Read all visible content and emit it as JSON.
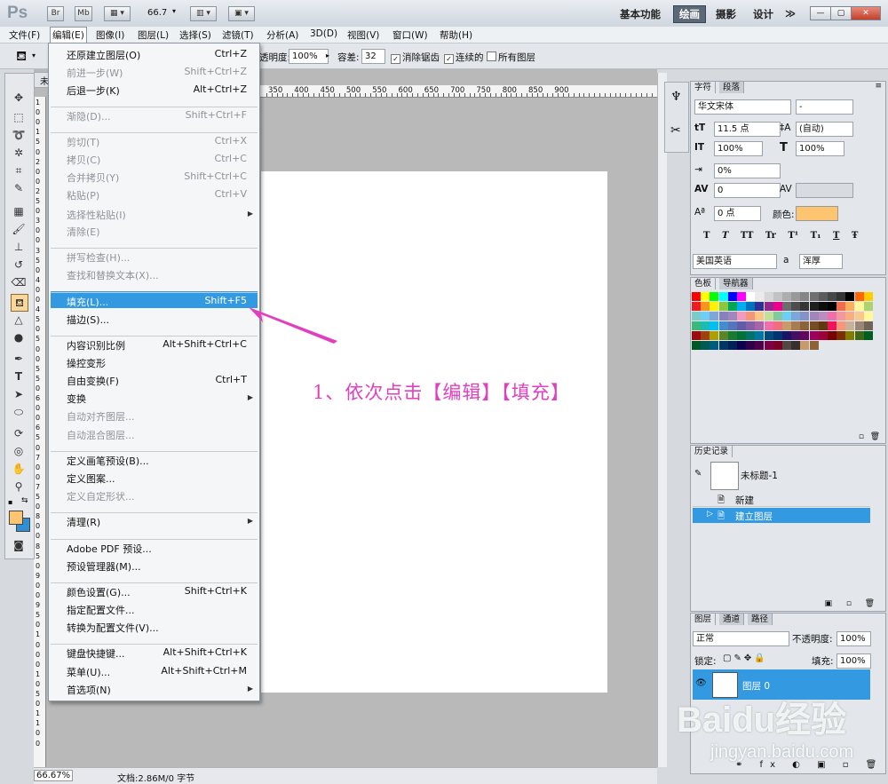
{
  "app": {
    "logo": "Ps",
    "zoom": "66.7",
    "bridge": "Br",
    "minibridge": "Mb"
  },
  "workspaces": [
    "基本功能",
    "绘画",
    "摄影",
    "设计",
    "≫"
  ],
  "menubar": [
    "文件(F)",
    "编辑(E)",
    "图像(I)",
    "图层(L)",
    "选择(S)",
    "滤镜(T)",
    "分析(A)",
    "3D(D)",
    "视图(V)",
    "窗口(W)",
    "帮助(H)"
  ],
  "options": {
    "opacity_label": "透明度:",
    "opacity": "100%",
    "tolerance_label": "容差:",
    "tolerance": "32",
    "antialias": "消除锯齿",
    "contiguous": "连续的",
    "all_layers": "所有图层"
  },
  "doc_tab": "未",
  "ruler_top": [
    "350",
    "400",
    "450",
    "500",
    "550",
    "600",
    "650",
    "700",
    "750",
    "800",
    "850",
    "900"
  ],
  "ruler_left": [
    "1",
    "0",
    "0",
    "1",
    "5",
    "0",
    "2",
    "0",
    "0",
    "2",
    "5",
    "0",
    "3",
    "0",
    "0",
    "3",
    "5",
    "0",
    "4",
    "0",
    "0",
    "4",
    "5",
    "0",
    "5",
    "0",
    "0",
    "5",
    "5",
    "0",
    "6",
    "0",
    "0",
    "6",
    "5",
    "0",
    "7",
    "0",
    "0",
    "7",
    "5",
    "0",
    "8",
    "0",
    "0",
    "8",
    "5",
    "0",
    "9",
    "0",
    "0",
    "9",
    "5",
    "0",
    "1",
    "0",
    "0",
    "0",
    "1",
    "0",
    "5",
    "0",
    "1",
    "1",
    "0",
    "0"
  ],
  "edit_menu": [
    {
      "label": "还原建立图层(O)",
      "shortcut": "Ctrl+Z",
      "disabled": false
    },
    {
      "label": "前进一步(W)",
      "shortcut": "Shift+Ctrl+Z",
      "disabled": true
    },
    {
      "label": "后退一步(K)",
      "shortcut": "Alt+Ctrl+Z",
      "disabled": false
    },
    {
      "label": "渐隐(D)...",
      "shortcut": "Shift+Ctrl+F",
      "disabled": true
    },
    {
      "label": "剪切(T)",
      "shortcut": "Ctrl+X",
      "disabled": true
    },
    {
      "label": "拷贝(C)",
      "shortcut": "Ctrl+C",
      "disabled": true
    },
    {
      "label": "合并拷贝(Y)",
      "shortcut": "Shift+Ctrl+C",
      "disabled": true
    },
    {
      "label": "粘贴(P)",
      "shortcut": "Ctrl+V",
      "disabled": true
    },
    {
      "label": "选择性粘贴(I)",
      "shortcut": "",
      "disabled": true
    },
    {
      "label": "清除(E)",
      "shortcut": "",
      "disabled": true
    },
    {
      "label": "拼写检查(H)...",
      "shortcut": "",
      "disabled": true
    },
    {
      "label": "查找和替换文本(X)...",
      "shortcut": "",
      "disabled": true
    },
    {
      "label": "填充(L)...",
      "shortcut": "Shift+F5",
      "disabled": false
    },
    {
      "label": "描边(S)...",
      "shortcut": "",
      "disabled": false
    },
    {
      "label": "内容识别比例",
      "shortcut": "Alt+Shift+Ctrl+C",
      "disabled": false
    },
    {
      "label": "操控变形",
      "shortcut": "",
      "disabled": false
    },
    {
      "label": "自由变换(F)",
      "shortcut": "Ctrl+T",
      "disabled": false
    },
    {
      "label": "变换",
      "shortcut": "",
      "disabled": false
    },
    {
      "label": "自动对齐图层...",
      "shortcut": "",
      "disabled": true
    },
    {
      "label": "自动混合图层...",
      "shortcut": "",
      "disabled": true
    },
    {
      "label": "定义画笔预设(B)...",
      "shortcut": "",
      "disabled": false
    },
    {
      "label": "定义图案...",
      "shortcut": "",
      "disabled": false
    },
    {
      "label": "定义自定形状...",
      "shortcut": "",
      "disabled": true
    },
    {
      "label": "清理(R)",
      "shortcut": "",
      "disabled": false
    },
    {
      "label": "Adobe PDF 预设...",
      "shortcut": "",
      "disabled": false
    },
    {
      "label": "预设管理器(M)...",
      "shortcut": "",
      "disabled": false
    },
    {
      "label": "颜色设置(G)...",
      "shortcut": "Shift+Ctrl+K",
      "disabled": false
    },
    {
      "label": "指定配置文件...",
      "shortcut": "",
      "disabled": false
    },
    {
      "label": "转换为配置文件(V)...",
      "shortcut": "",
      "disabled": false
    },
    {
      "label": "键盘快捷键...",
      "shortcut": "Alt+Shift+Ctrl+K",
      "disabled": false
    },
    {
      "label": "菜单(U)...",
      "shortcut": "Alt+Shift+Ctrl+M",
      "disabled": false
    },
    {
      "label": "首选项(N)",
      "shortcut": "",
      "disabled": false
    }
  ],
  "annotation": "1、依次点击【编辑】【填充】",
  "character": {
    "tabs": [
      "字符",
      "段落"
    ],
    "font_family": "华文宋体",
    "font_style": "-",
    "size": "11.5 点",
    "leading": "(自动)",
    "vscale": "100%",
    "hscale": "100%",
    "tsume": "0%",
    "tracking": "0",
    "baseline": "0 点",
    "color_label": "颜色:",
    "styles": [
      "T",
      "T",
      "TT",
      "Tr",
      "T¹",
      "T₁",
      "T",
      "Ŧ"
    ],
    "language": "美国英语",
    "aa_label": "a",
    "aa": "浑厚"
  },
  "swatches": {
    "tabs": [
      "色板",
      "导航器"
    ]
  },
  "history": {
    "tab": "历史记录",
    "snapshot": "未标题-1",
    "items": [
      "新建",
      "建立图层"
    ]
  },
  "layers": {
    "tabs": [
      "图层",
      "通道",
      "路径"
    ],
    "blend": "正常",
    "opacity_label": "不透明度:",
    "opacity": "100%",
    "lock_label": "锁定:",
    "fill_label": "填充:",
    "fill": "100%",
    "layer_name": "图层 0"
  },
  "status": {
    "zoom": "66.67%",
    "doc": "文档:2.86M/0 字节"
  },
  "watermark": {
    "main": "Baidu经验",
    "sub": "jingyan.baidu.com"
  },
  "colors": {
    "highlight": "#3399e0",
    "annotation": "#e040c0",
    "fg": "#fdc572",
    "bg": "#2f8fd4"
  }
}
